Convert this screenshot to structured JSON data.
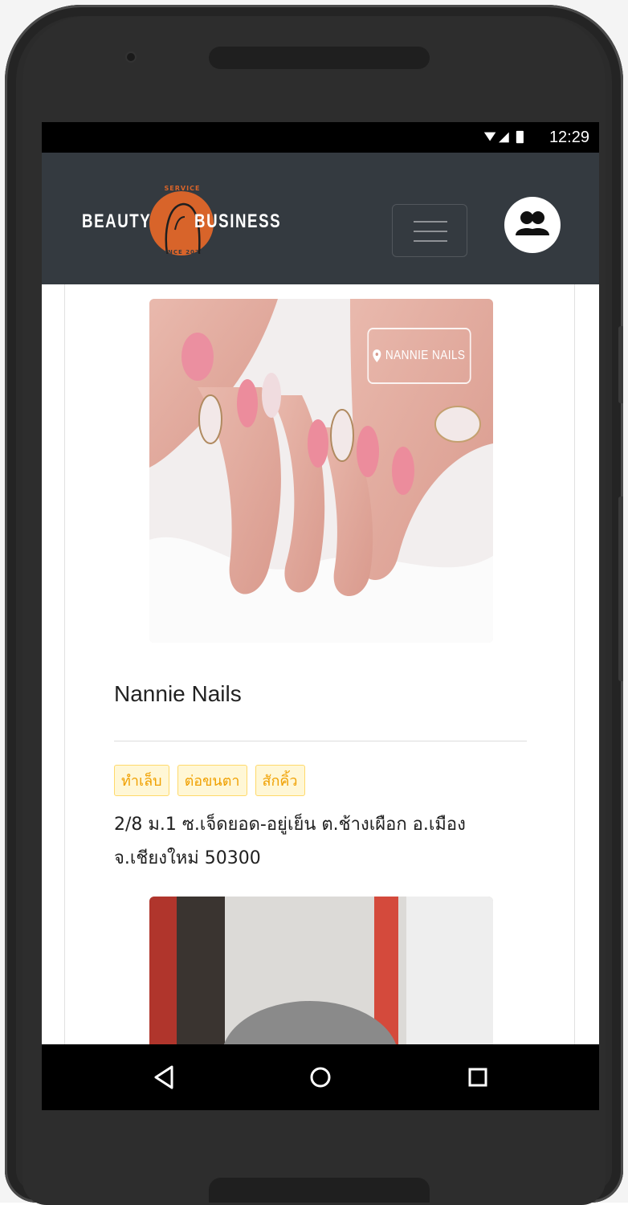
{
  "status_bar": {
    "time": "12:29"
  },
  "header": {
    "logo": {
      "left_text": "BEAUTY",
      "right_text": "BUSINESS",
      "top_text": "SERVICE",
      "bottom_text": "SINCE 2020",
      "accent_color": "#d8642a"
    },
    "menu_icon": "hamburger-icon",
    "user_icon": "users-icon",
    "background_color": "#343a40"
  },
  "listing": {
    "photo_overlay_label": "NANNIE NAILS",
    "name": "Nannie Nails",
    "tags": [
      "ทำเล็บ",
      "ต่อขนตา",
      "สักคิ้ว"
    ],
    "address": "2/8 ม.1 ซ.เจ็ดยอด-อยู่เย็น ต.ช้างเผือก อ.เมือง จ.เชียงใหม่ 50300",
    "tag_color": "#f0a000"
  },
  "system_nav": {
    "back_icon": "back-triangle-icon",
    "home_icon": "home-circle-icon",
    "recents_icon": "recents-square-icon"
  }
}
